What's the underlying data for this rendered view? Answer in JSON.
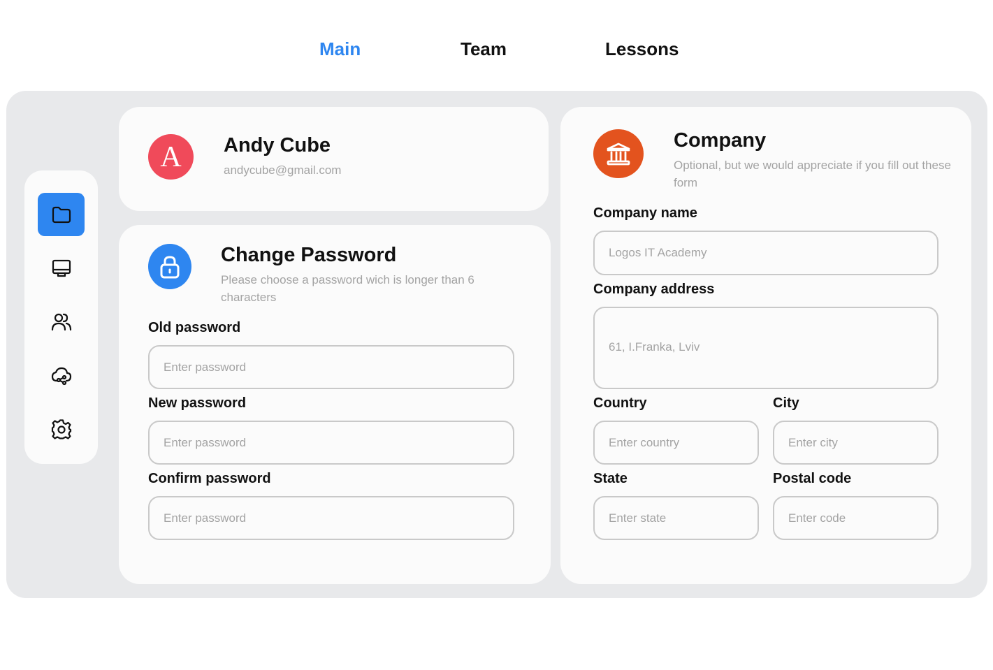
{
  "nav": {
    "tabs": [
      {
        "label": "Main",
        "active": true
      },
      {
        "label": "Team",
        "active": false
      },
      {
        "label": "Lessons",
        "active": false
      }
    ]
  },
  "sidebar": {
    "items": [
      {
        "icon": "folder-icon",
        "active": true
      },
      {
        "icon": "monitor-icon",
        "active": false
      },
      {
        "icon": "users-icon",
        "active": false
      },
      {
        "icon": "cloud-share-icon",
        "active": false
      },
      {
        "icon": "gear-icon",
        "active": false
      }
    ]
  },
  "profile": {
    "avatar_letter": "A",
    "name": "Andy Cube",
    "email": "andycube@gmail.com"
  },
  "password": {
    "title": "Change Password",
    "subtitle": "Please choose a password wich is longer than 6 characters",
    "old_label": "Old password",
    "old_placeholder": "Enter password",
    "new_label": "New password",
    "new_placeholder": "Enter password",
    "confirm_label": "Confirm password",
    "confirm_placeholder": "Enter password"
  },
  "company": {
    "title": "Company",
    "subtitle": "Optional, but we would appreciate if you fill out these form",
    "name_label": "Company name",
    "name_placeholder": "Logos IT Academy",
    "address_label": "Company address",
    "address_placeholder": "61, I.Franka, Lviv",
    "country_label": "Country",
    "country_placeholder": "Enter country",
    "city_label": "City",
    "city_placeholder": "Enter city",
    "state_label": "State",
    "state_placeholder": "Enter state",
    "postal_label": "Postal code",
    "postal_placeholder": "Enter code"
  },
  "colors": {
    "accent": "#2e86f0",
    "avatar": "#f04a5a",
    "company_icon": "#e3531e",
    "panel_bg": "#e8e9eb",
    "card_bg": "#fbfbfb"
  }
}
